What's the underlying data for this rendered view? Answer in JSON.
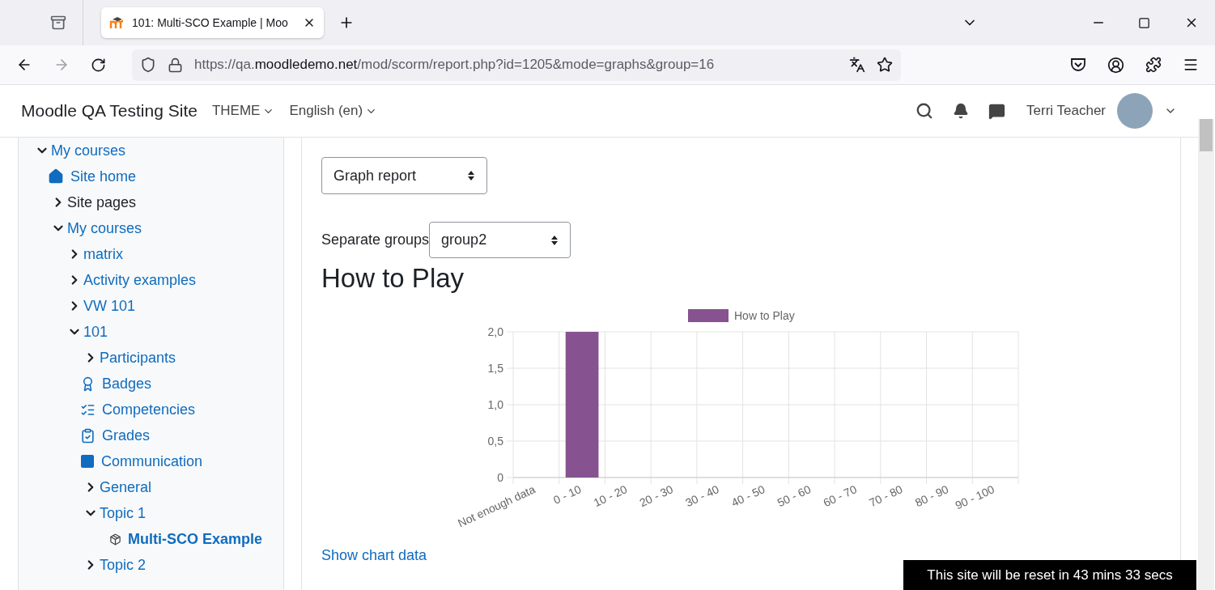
{
  "browser": {
    "tab_title": "101: Multi-SCO Example | Moo",
    "url_prefix": "https://qa.",
    "url_domain": "moodledemo.net",
    "url_path": "/mod/scorm/report.php?id=1205&mode=graphs&group=16"
  },
  "navbar": {
    "site_name": "Moodle QA Testing Site",
    "menus": [
      "THEME",
      "English (en)"
    ],
    "user_name": "Terri Teacher"
  },
  "sidebar": {
    "items": [
      {
        "label": "My courses",
        "kind": "toggle",
        "expanded": true,
        "children": [
          {
            "label": "Site home",
            "kind": "home"
          },
          {
            "label": "Site pages",
            "kind": "toggle",
            "expanded": false,
            "plain": true
          },
          {
            "label": "My courses",
            "kind": "toggle",
            "expanded": true,
            "children": [
              {
                "label": "matrix",
                "kind": "toggle",
                "expanded": false
              },
              {
                "label": "Activity examples",
                "kind": "toggle",
                "expanded": false
              },
              {
                "label": "VW 101",
                "kind": "toggle",
                "expanded": false
              },
              {
                "label": "101",
                "kind": "toggle",
                "expanded": true,
                "children": [
                  {
                    "label": "Participants",
                    "kind": "toggle",
                    "expanded": false
                  },
                  {
                    "label": "Badges",
                    "kind": "badge"
                  },
                  {
                    "label": "Competencies",
                    "kind": "checklist"
                  },
                  {
                    "label": "Grades",
                    "kind": "grades"
                  },
                  {
                    "label": "Communication",
                    "kind": "square"
                  },
                  {
                    "label": "General",
                    "kind": "toggle",
                    "expanded": false
                  },
                  {
                    "label": "Topic 1",
                    "kind": "toggle",
                    "expanded": true,
                    "children": [
                      {
                        "label": "Multi-SCO Example",
                        "kind": "package",
                        "current": true
                      }
                    ]
                  },
                  {
                    "label": "Topic 2",
                    "kind": "toggle",
                    "expanded": false
                  }
                ]
              }
            ]
          }
        ]
      }
    ]
  },
  "report": {
    "report_select": "Graph report",
    "group_label": "Separate groups",
    "group_select": "group2",
    "heading": "How to Play",
    "chart_data": {
      "type": "bar",
      "categories": [
        "Not enough data",
        "0 - 10",
        "10 - 20",
        "20 - 30",
        "30 - 40",
        "40 - 50",
        "50 - 60",
        "60 - 70",
        "70 - 80",
        "80 - 90",
        "90 - 100"
      ],
      "series": [
        {
          "name": "How to Play",
          "color": "#86528f",
          "values": [
            0,
            2,
            0,
            0,
            0,
            0,
            0,
            0,
            0,
            0,
            0
          ]
        }
      ],
      "ylim": [
        0,
        2
      ],
      "grid": true,
      "yticks": [
        {
          "value": 0,
          "label": "0"
        },
        {
          "value": 0.5,
          "label": "0,5"
        },
        {
          "value": 1,
          "label": "1,0"
        },
        {
          "value": 1.5,
          "label": "1,5"
        },
        {
          "value": 2,
          "label": "2,0"
        }
      ]
    },
    "chart_link": "Show chart data"
  },
  "notice": "This site will be reset in 43 mins 33 secs"
}
